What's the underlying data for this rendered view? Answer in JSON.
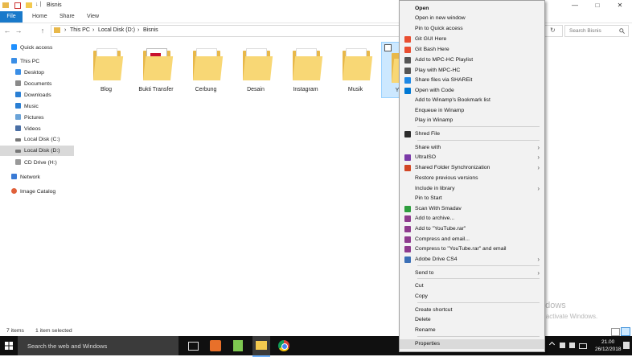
{
  "window": {
    "title": "Bisnis",
    "quick_access_glyph": "↓ |",
    "ctrl_min": "—",
    "ctrl_max": "□",
    "ctrl_close": "✕"
  },
  "ribbon": {
    "file": "File",
    "tabs": [
      "Home",
      "Share",
      "View"
    ]
  },
  "address": {
    "back": "←",
    "forward": "→",
    "up": "↑",
    "crumbs": [
      "This PC",
      "Local Disk (D:)",
      "Bisnis"
    ],
    "sep": "›",
    "refresh": "↻",
    "search_placeholder": "Search Bisnis"
  },
  "nav": [
    {
      "label": "Quick access",
      "icon": "star-icon",
      "color": "#1e90ff"
    },
    {
      "label": "This PC",
      "icon": "computer-icon",
      "color": "#3a8ee6"
    },
    {
      "label": "Desktop",
      "icon": "desktop-icon",
      "color": "#3a8ee6"
    },
    {
      "label": "Documents",
      "icon": "documents-icon",
      "color": "#8a8a8a"
    },
    {
      "label": "Downloads",
      "icon": "downloads-icon",
      "color": "#2a7fd4"
    },
    {
      "label": "Music",
      "icon": "music-icon",
      "color": "#2a7fd4"
    },
    {
      "label": "Pictures",
      "icon": "pictures-icon",
      "color": "#6aa3d8"
    },
    {
      "label": "Videos",
      "icon": "videos-icon",
      "color": "#4a6fa5"
    },
    {
      "label": "Local Disk (C:)",
      "icon": "drive-icon",
      "color": "#777777"
    },
    {
      "label": "Local Disk (D:)",
      "icon": "drive-icon",
      "color": "#777777"
    },
    {
      "label": "CD Drive (H:)",
      "icon": "cd-drive-icon",
      "color": "#999999"
    },
    {
      "label": "Network",
      "icon": "network-icon",
      "color": "#3a7bd5"
    },
    {
      "label": "Image Catalog",
      "icon": "image-catalog-icon",
      "color": "#e0603a"
    }
  ],
  "files": [
    {
      "label": "Blog"
    },
    {
      "label": "Bukti Transfer"
    },
    {
      "label": "Cerbung"
    },
    {
      "label": "Desain"
    },
    {
      "label": "Instagram"
    },
    {
      "label": "Musik"
    },
    {
      "label": "Y"
    }
  ],
  "context_menu": {
    "items": [
      {
        "label": "Open",
        "bold": true
      },
      {
        "label": "Open in new window"
      },
      {
        "label": "Pin to Quick access"
      },
      {
        "label": "Git GUI Here",
        "icon": "git-icon",
        "color": "#e94e31"
      },
      {
        "label": "Git Bash Here",
        "icon": "git-icon",
        "color": "#e94e31"
      },
      {
        "label": "Add to MPC-HC Playlist",
        "icon": "mpc-icon",
        "color": "#555555"
      },
      {
        "label": "Play with MPC-HC",
        "icon": "mpc-icon",
        "color": "#555555"
      },
      {
        "label": "Share files via SHAREit",
        "icon": "shareit-icon",
        "color": "#1e88e5"
      },
      {
        "label": "Open with Code",
        "icon": "vscode-icon",
        "color": "#0078d4"
      },
      {
        "label": "Add to Winamp's Bookmark list"
      },
      {
        "label": "Enqueue in Winamp"
      },
      {
        "label": "Play in Winamp"
      },
      {
        "label": "Shred File",
        "icon": "shred-icon",
        "color": "#2b2b2b"
      },
      {
        "label": "Share with",
        "submenu": true
      },
      {
        "label": "UltraISO",
        "icon": "ultraiso-icon",
        "color": "#7b3aa8",
        "submenu": true
      },
      {
        "label": "Shared Folder Synchronization",
        "icon": "sync-icon",
        "color": "#d24726",
        "submenu": true
      },
      {
        "label": "Restore previous versions"
      },
      {
        "label": "Include in library",
        "submenu": true
      },
      {
        "label": "Pin to Start"
      },
      {
        "label": "Scan With Smadav",
        "icon": "smadav-icon",
        "color": "#2e9e3e"
      },
      {
        "label": "Add to archive...",
        "icon": "winrar-icon",
        "color": "#8e3b8e"
      },
      {
        "label": "Add to \"YouTube.rar\"",
        "icon": "winrar-icon",
        "color": "#8e3b8e"
      },
      {
        "label": "Compress and email...",
        "icon": "winrar-icon",
        "color": "#8e3b8e"
      },
      {
        "label": "Compress to \"YouTube.rar\" and email",
        "icon": "winrar-icon",
        "color": "#8e3b8e"
      },
      {
        "label": "Adobe Drive CS4",
        "icon": "adobe-drive-icon",
        "color": "#3b6fb6",
        "submenu": true
      },
      {
        "label": "Send to",
        "submenu": true
      },
      {
        "label": "Cut"
      },
      {
        "label": "Copy"
      },
      {
        "label": "Create shortcut"
      },
      {
        "label": "Delete"
      },
      {
        "label": "Rename"
      },
      {
        "label": "Properties"
      }
    ],
    "submenu_arrow": "›"
  },
  "status": {
    "items": "7 items",
    "selected": "1 item selected"
  },
  "watermark": {
    "line1": "Activate Windows",
    "line2": "Go to Settings to activate Windows."
  },
  "taskbar": {
    "search": "Search the web and Windows",
    "time": "21.00",
    "date": "26/12/2018"
  }
}
